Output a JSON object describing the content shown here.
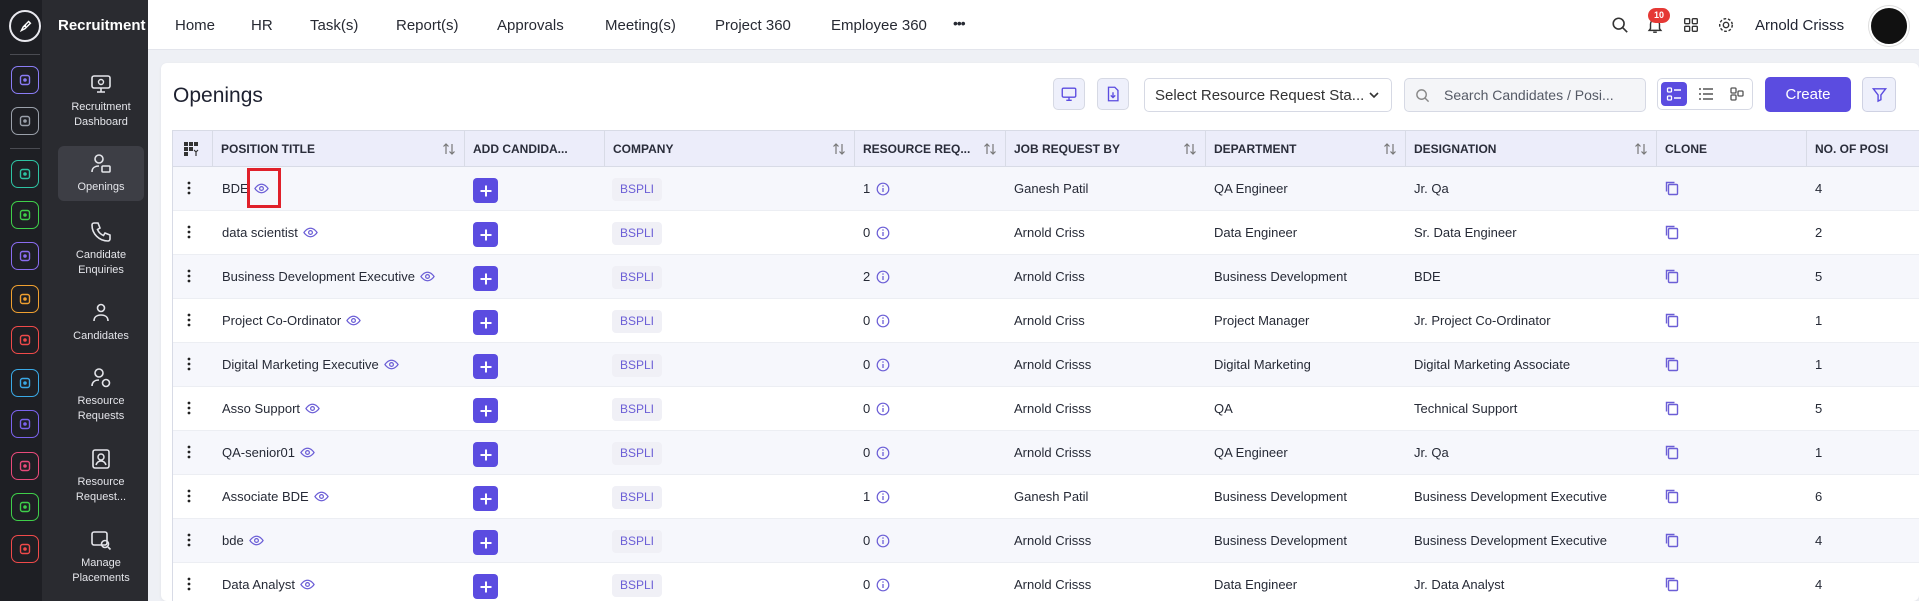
{
  "app": {
    "module_title": "Recruitment"
  },
  "rail": {
    "icons": [
      {
        "name": "home",
        "color": "#8a7cf5"
      },
      {
        "name": "pin",
        "color": "#9aa0aa"
      },
      {
        "name": "people-chart",
        "color": "#2ec3a3"
      },
      {
        "name": "robot",
        "color": "#3fcf4a"
      },
      {
        "name": "briefcase",
        "color": "#8a6cf0"
      },
      {
        "name": "wheat",
        "color": "#f0a030"
      },
      {
        "name": "target",
        "color": "#f04a4a"
      },
      {
        "name": "archive",
        "color": "#3aa9e6"
      },
      {
        "name": "airplane",
        "color": "#7b63ee"
      },
      {
        "name": "monitor",
        "color": "#e84a7a"
      },
      {
        "name": "document",
        "color": "#3fcf4a"
      },
      {
        "name": "ribbon",
        "color": "#f04a4a"
      }
    ]
  },
  "sidebar": {
    "items": [
      {
        "label": "Recruitment Dashboard"
      },
      {
        "label": "Openings"
      },
      {
        "label": "Candidate Enquiries"
      },
      {
        "label": "Candidates"
      },
      {
        "label": "Resource Requests"
      },
      {
        "label": "Resource Request..."
      },
      {
        "label": "Manage Placements"
      }
    ]
  },
  "nav": {
    "items": [
      "Home",
      "HR",
      "Task(s)",
      "Report(s)",
      "Approvals",
      "Meeting(s)",
      "Project 360",
      "Employee 360"
    ],
    "more": "•••",
    "notification_count": "10",
    "user_name": "Arnold Crisss"
  },
  "page": {
    "title": "Openings",
    "status_select": "Select Resource Request Sta...",
    "search_placeholder": "Search Candidates / Posi...",
    "create_label": "Create"
  },
  "table": {
    "headers": [
      "POSITION TITLE",
      "ADD CANDIDA...",
      "COMPANY",
      "RESOURCE REQ...",
      "JOB REQUEST BY",
      "DEPARTMENT",
      "DESIGNATION",
      "CLONE",
      "NO. OF POSI"
    ],
    "rows": [
      {
        "title": "BDE",
        "company": "BSPLI",
        "resource": "1",
        "requested_by": "Ganesh Patil",
        "department": "QA Engineer",
        "designation": "Jr. Qa",
        "positions": "4"
      },
      {
        "title": "data scientist",
        "company": "BSPLI",
        "resource": "0",
        "requested_by": "Arnold Criss",
        "department": "Data Engineer",
        "designation": "Sr. Data Engineer",
        "positions": "2"
      },
      {
        "title": "Business Development Executive",
        "company": "BSPLI",
        "resource": "2",
        "requested_by": "Arnold Criss",
        "department": "Business Development",
        "designation": "BDE",
        "positions": "5"
      },
      {
        "title": "Project Co-Ordinator",
        "company": "BSPLI",
        "resource": "0",
        "requested_by": "Arnold Criss",
        "department": "Project Manager",
        "designation": "Jr. Project Co-Ordinator",
        "positions": "1"
      },
      {
        "title": "Digital Marketing Executive",
        "company": "BSPLI",
        "resource": "0",
        "requested_by": "Arnold Crisss",
        "department": "Digital Marketing",
        "designation": "Digital Marketing Associate",
        "positions": "1"
      },
      {
        "title": "Asso Support",
        "company": "BSPLI",
        "resource": "0",
        "requested_by": "Arnold Crisss",
        "department": "QA",
        "designation": "Technical Support",
        "positions": "5"
      },
      {
        "title": "QA-senior01",
        "company": "BSPLI",
        "resource": "0",
        "requested_by": "Arnold Crisss",
        "department": "QA Engineer",
        "designation": "Jr. Qa",
        "positions": "1"
      },
      {
        "title": "Associate BDE",
        "company": "BSPLI",
        "resource": "1",
        "requested_by": "Ganesh Patil",
        "department": "Business Development",
        "designation": "Business Development Executive",
        "positions": "6"
      },
      {
        "title": "bde",
        "company": "BSPLI",
        "resource": "0",
        "requested_by": "Arnold Crisss",
        "department": "Business Development",
        "designation": "Business Development Executive",
        "positions": "4"
      },
      {
        "title": "Data Analyst",
        "company": "BSPLI",
        "resource": "0",
        "requested_by": "Arnold Crisss",
        "department": "Data Engineer",
        "designation": "Jr. Data Analyst",
        "positions": "4"
      }
    ]
  },
  "colors": {
    "accent": "#5b4ce0",
    "chip_text": "#6b5ed6",
    "highlight": "#e0202a"
  }
}
